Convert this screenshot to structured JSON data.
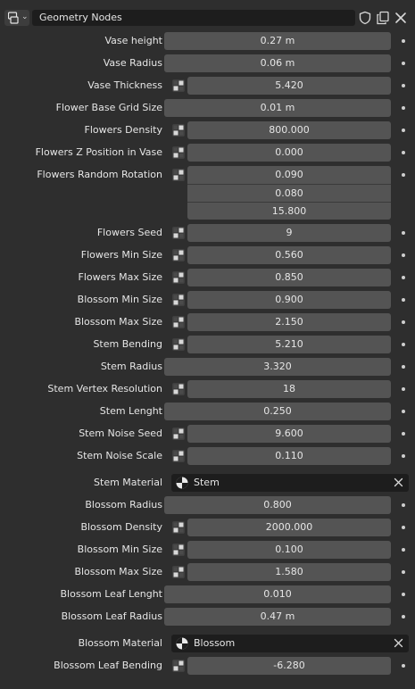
{
  "header": {
    "modifier_name": "Geometry Nodes"
  },
  "rows": [
    {
      "label": "Vase height",
      "value": "0.27 m"
    },
    {
      "label": "Vase Radius",
      "value": "0.06 m"
    },
    {
      "label": "Vase Thickness",
      "value": "5.420"
    },
    {
      "label": "Flower Base Grid Size",
      "value": "0.01 m"
    },
    {
      "label": "Flowers Density",
      "value": "800.000"
    },
    {
      "label": "Flowers Z Position in Vase",
      "value": "0.000"
    },
    {
      "label": "Flowers Random Rotation",
      "values": [
        "0.090",
        "0.080",
        "15.800"
      ]
    },
    {
      "label": "Flowers Seed",
      "value": "9"
    },
    {
      "label": "Flowers Min Size",
      "value": "0.560"
    },
    {
      "label": "Flowers Max Size",
      "value": "0.850"
    },
    {
      "label": "Blossom Min Size",
      "value": "0.900"
    },
    {
      "label": "Blossom Max Size",
      "value": "2.150"
    },
    {
      "label": "Stem Bending",
      "value": "5.210"
    },
    {
      "label": "Stem Radius",
      "value": "3.320"
    },
    {
      "label": "Stem Vertex Resolution",
      "value": "18"
    },
    {
      "label": "Stem Lenght",
      "value": "0.250"
    },
    {
      "label": "Stem Noise Seed",
      "value": "9.600"
    },
    {
      "label": "Stem Noise Scale",
      "value": "0.110"
    },
    {
      "label": "Stem Material",
      "value": "Stem"
    },
    {
      "label": "Blossom Radius",
      "value": "0.800"
    },
    {
      "label": "Blossom Density",
      "value": "2000.000"
    },
    {
      "label": "Blossom Min Size",
      "value": "0.100"
    },
    {
      "label": "Blossom Max Size",
      "value": "1.580"
    },
    {
      "label": "Blossom Leaf Lenght",
      "value": "0.010"
    },
    {
      "label": "Blossom Leaf Radius",
      "value": "0.47 m"
    },
    {
      "label": "Blossom Material",
      "value": "Blossom"
    },
    {
      "label": "Blossom Leaf Bending",
      "value": "-6.280"
    }
  ]
}
